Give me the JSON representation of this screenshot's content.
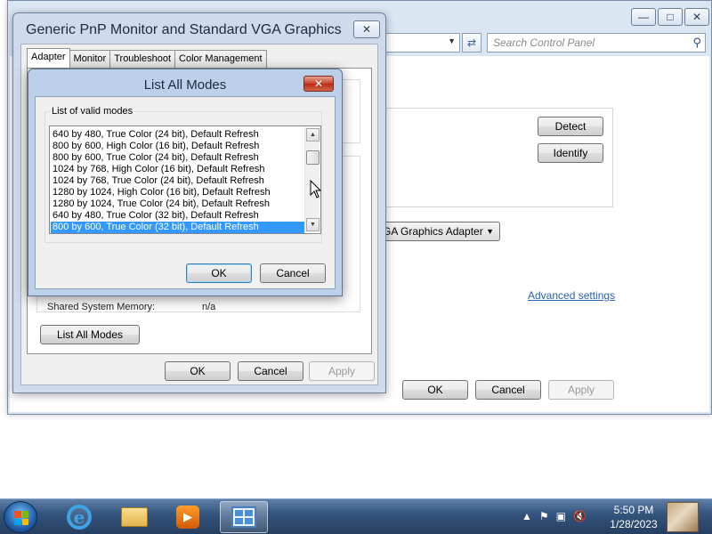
{
  "background_window": {
    "search": {
      "placeholder": "Search Control Panel"
    },
    "detect_label": "Detect",
    "identify_label": "Identify",
    "adapter_dropdown_value": "GA Graphics Adapter",
    "advanced_settings_link": "Advanced settings",
    "ok_label": "OK",
    "cancel_label": "Cancel",
    "apply_label": "Apply"
  },
  "properties_dialog": {
    "title": "Generic PnP Monitor and Standard VGA Graphics ...",
    "tabs": [
      {
        "label": "Adapter"
      },
      {
        "label": "Monitor"
      },
      {
        "label": "Troubleshoot"
      },
      {
        "label": "Color Management"
      }
    ],
    "shared_memory_label": "Shared System Memory:",
    "shared_memory_value": "n/a",
    "list_all_modes_label": "List All Modes",
    "ok_label": "OK",
    "cancel_label": "Cancel",
    "apply_label": "Apply"
  },
  "modes_dialog": {
    "title": "List All Modes",
    "group_label": "List of valid modes",
    "modes": [
      "640 by 480, True Color (24 bit), Default Refresh",
      "800 by 600, High Color (16 bit), Default Refresh",
      "800 by 600, True Color (24 bit), Default Refresh",
      "1024 by 768, High Color (16 bit), Default Refresh",
      "1024 by 768, True Color (24 bit), Default Refresh",
      "1280 by 1024, High Color (16 bit), Default Refresh",
      "1280 by 1024, True Color (24 bit), Default Refresh",
      "640 by 480, True Color (32 bit), Default Refresh",
      "800 by 600, True Color (32 bit), Default Refresh"
    ],
    "selected_index": 8,
    "ok_label": "OK",
    "cancel_label": "Cancel"
  },
  "taskbar": {
    "time": "5:50 PM",
    "date": "1/28/2023",
    "icons": [
      "start-orb",
      "internet-explorer-icon",
      "windows-explorer-icon",
      "media-player-icon",
      "control-panel-icon"
    ]
  },
  "colors": {
    "selection": "#3399ff",
    "link": "#2a63b0",
    "close_red": "#c8432b"
  }
}
